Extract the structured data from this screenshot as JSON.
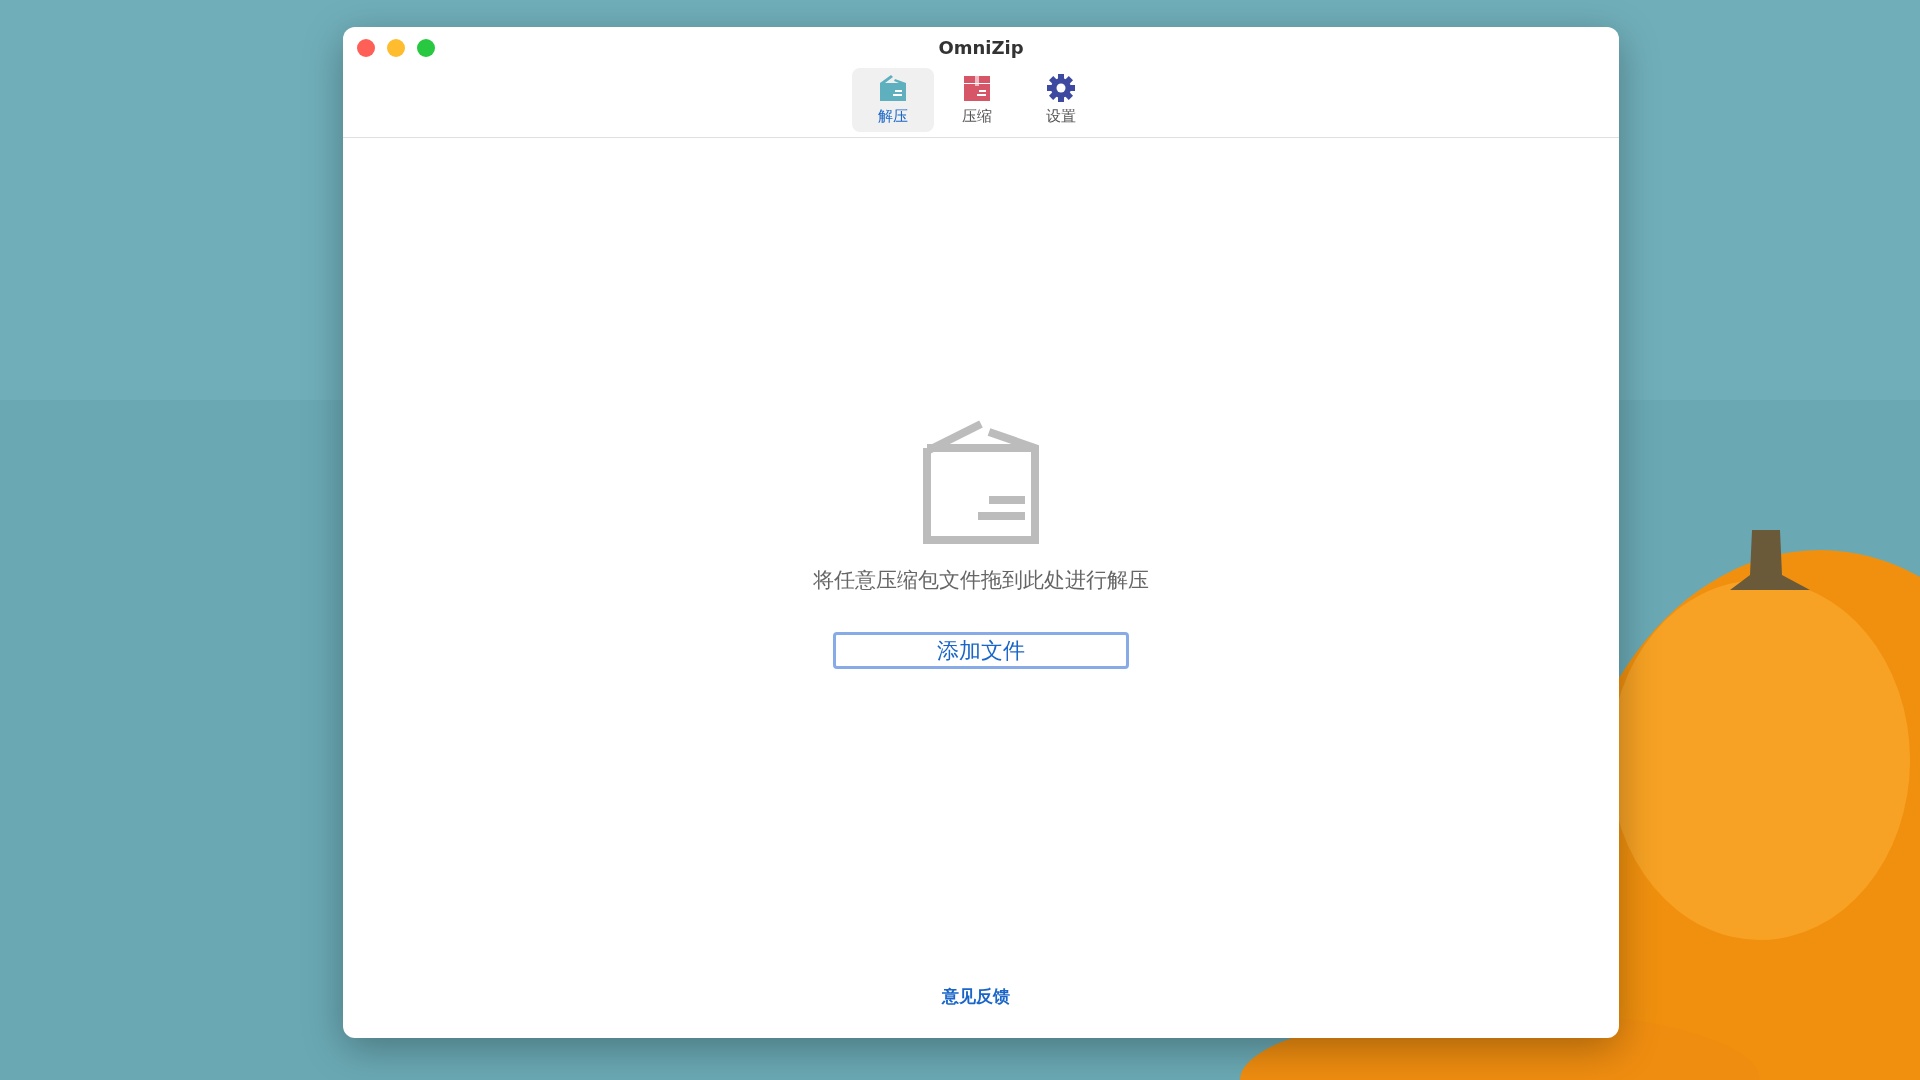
{
  "window": {
    "title": "OmniZip"
  },
  "tabs": [
    {
      "label": "解压",
      "kind": "extract",
      "selected": true
    },
    {
      "label": "压缩",
      "kind": "compress",
      "selected": false
    },
    {
      "label": "设置",
      "kind": "settings",
      "selected": false
    }
  ],
  "drop_zone": {
    "message": "将任意压缩包文件拖到此处进行解压",
    "button": "添加文件"
  },
  "footer_link": "意见反馈"
}
